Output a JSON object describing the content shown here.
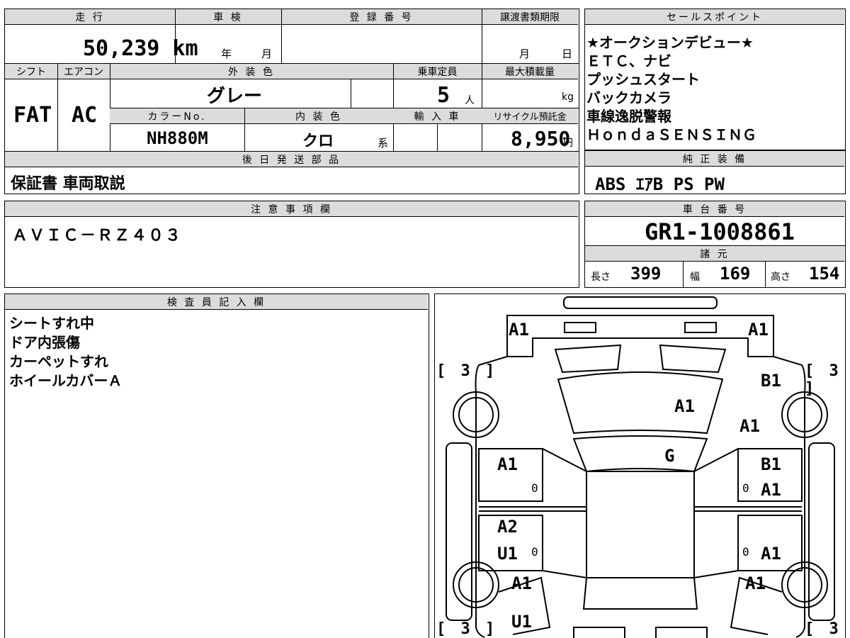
{
  "top": {
    "mileage_label": "走 行",
    "mileage_value": "50,239 km",
    "inspection_label": "車 検",
    "inspection_year": "年",
    "inspection_month": "月",
    "registration_label": "登 録 番 号",
    "transfer_label": "譲渡書類期限",
    "transfer_month": "月",
    "transfer_day": "日",
    "shift_label": "シフト",
    "shift_value": "FAT",
    "ac_label": "エアコン",
    "ac_value": "AC",
    "exterior_label": "外 装 色",
    "exterior_value": "グレー",
    "capacity_label": "乗車定員",
    "capacity_value": "5",
    "capacity_unit": "人",
    "maxload_label": "最大積載量",
    "maxload_unit": "kg",
    "color_no_label": "カラーNo.",
    "color_no_value": "NH880M",
    "interior_label": "内 装 色",
    "interior_value": "クロ",
    "interior_suffix": "系",
    "import_label": "輸 入 車",
    "recycle_label": "リサイクル預託金",
    "recycle_value": "8,950",
    "recycle_unit": "円",
    "later_label": "後 日 発 送 部 品",
    "later_value": "保証書 車両取説"
  },
  "sales": {
    "label": "セールスポイント",
    "lines": [
      "★オークションデビュー★",
      "ＥＴＣ、ナビ",
      "プッシュスタート",
      "バックカメラ",
      "車線逸脱警報",
      "ＨｏｎｄａＳＥＮＳＩＮＧ"
    ]
  },
  "equipment": {
    "label": "純 正 装 備",
    "value": "ABS ｴｱB PS PW"
  },
  "notes": {
    "label": "注 意 事 項 欄",
    "value": "ＡＶＩＣ－ＲＺ４０３"
  },
  "chassis": {
    "label": "車 台 番 号",
    "value": "GR1-1008861",
    "spec_label": "諸 元",
    "length_label": "長さ",
    "length_value": "399",
    "width_label": "幅",
    "width_value": "169",
    "height_label": "高さ",
    "height_value": "154"
  },
  "inspector": {
    "label": "検 査 員 記 入 欄",
    "lines": [
      "シートすれ中",
      "ドア内張傷",
      "カーペットすれ",
      "ホイールカバーＡ"
    ]
  },
  "diagram": {
    "marks": {
      "front_left": "A1",
      "front_right": "A1",
      "bracket_tl": "[ 3 ]",
      "bracket_tr": "[ 3 ]",
      "bracket_bl": "[ 3 ]",
      "bracket_br": "[ 3 ]",
      "fender_right": "B1",
      "hood": "A1",
      "fender_right2": "A1",
      "windshield": "G",
      "door_fl": "A1",
      "door_fr_1": "B1",
      "door_fr_2": "A1",
      "door_rl_1": "A2",
      "door_rl_2": "U1",
      "door_rr": "A1",
      "rear_left": "A1",
      "rear_right": "A1",
      "rear_bottom": "U1",
      "zero": "0"
    }
  }
}
